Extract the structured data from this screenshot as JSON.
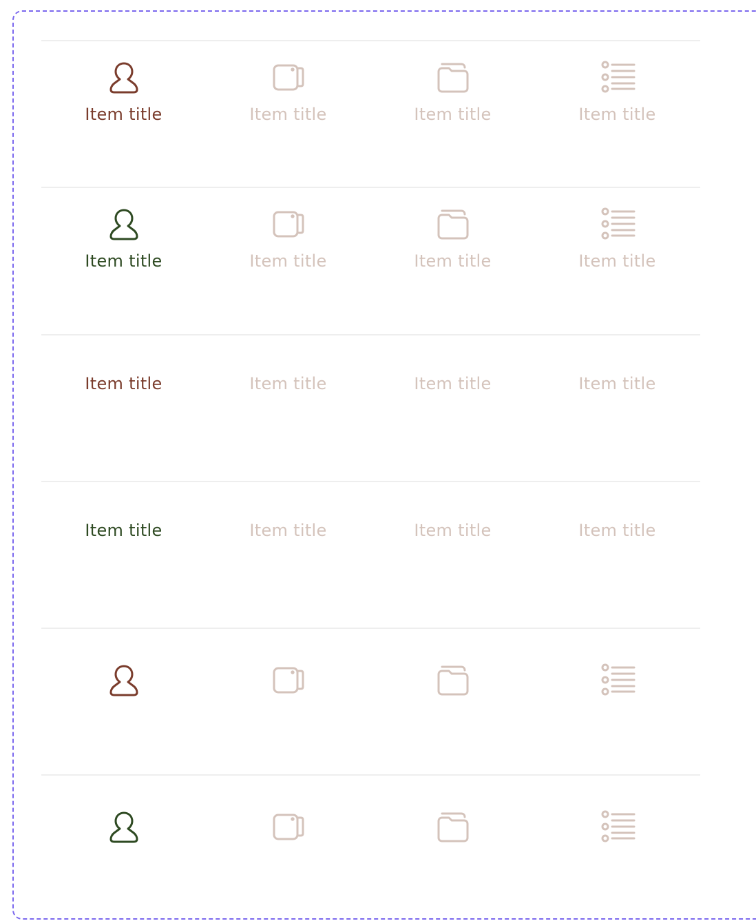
{
  "colors": {
    "active_brown": "#7a3c2c",
    "active_green": "#2e4a22",
    "inactive": "#d4c3bb",
    "divider": "#eeeeee",
    "frame_dash": "#7b68ee"
  },
  "tabbars": [
    {
      "variant": "icon-and-label",
      "active_color": "brown",
      "items": [
        {
          "label": "Item title",
          "icon": "user-icon",
          "active": true
        },
        {
          "label": "Item title",
          "icon": "video-icon",
          "active": false
        },
        {
          "label": "Item title",
          "icon": "folder-icon",
          "active": false
        },
        {
          "label": "Item title",
          "icon": "list-icon",
          "active": false
        }
      ]
    },
    {
      "variant": "icon-and-label",
      "active_color": "green",
      "items": [
        {
          "label": "Item title",
          "icon": "user-icon",
          "active": true
        },
        {
          "label": "Item title",
          "icon": "video-icon",
          "active": false
        },
        {
          "label": "Item title",
          "icon": "folder-icon",
          "active": false
        },
        {
          "label": "Item title",
          "icon": "list-icon",
          "active": false
        }
      ]
    },
    {
      "variant": "label-only",
      "active_color": "brown",
      "items": [
        {
          "label": "Item title",
          "active": true
        },
        {
          "label": "Item title",
          "active": false
        },
        {
          "label": "Item title",
          "active": false
        },
        {
          "label": "Item title",
          "active": false
        }
      ]
    },
    {
      "variant": "label-only",
      "active_color": "green",
      "items": [
        {
          "label": "Item title",
          "active": true
        },
        {
          "label": "Item title",
          "active": false
        },
        {
          "label": "Item title",
          "active": false
        },
        {
          "label": "Item title",
          "active": false
        }
      ]
    },
    {
      "variant": "icon-only",
      "active_color": "brown",
      "items": [
        {
          "icon": "user-icon",
          "active": true
        },
        {
          "icon": "video-icon",
          "active": false
        },
        {
          "icon": "folder-icon",
          "active": false
        },
        {
          "icon": "list-icon",
          "active": false
        }
      ]
    },
    {
      "variant": "icon-only",
      "active_color": "green",
      "items": [
        {
          "icon": "user-icon",
          "active": true
        },
        {
          "icon": "video-icon",
          "active": false
        },
        {
          "icon": "folder-icon",
          "active": false
        },
        {
          "icon": "list-icon",
          "active": false
        }
      ]
    }
  ]
}
